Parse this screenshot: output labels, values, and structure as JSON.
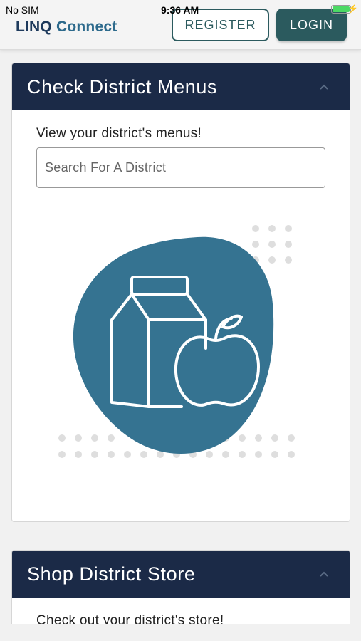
{
  "status": {
    "carrier": "No SIM",
    "time": "9:36 AM",
    "battery_level": 1.0
  },
  "header": {
    "logo_prefix": "LINQ",
    "logo_suffix": " Connect",
    "register_label": "REGISTER",
    "login_label": "LOGIN"
  },
  "menus_card": {
    "title": "Check District Menus",
    "prompt": "View your district's menus!",
    "search_placeholder": "Search For A District",
    "illustration": "milk-carton-and-apple"
  },
  "store_card": {
    "title": "Shop District Store",
    "prompt": "Check out your district's store!"
  },
  "colors": {
    "header_navy": "#1b2a47",
    "brand_teal": "#2b5a5e",
    "blob_blue": "#357391",
    "logo_blue": "#2d6a8c"
  }
}
